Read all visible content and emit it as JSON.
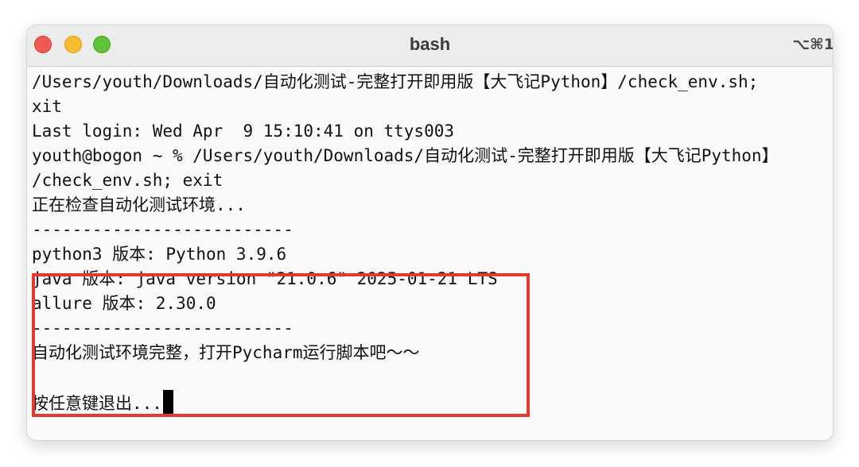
{
  "window": {
    "title": "bash",
    "shortcut": "⌥⌘1",
    "traffic_lights": {
      "close_icon": "×",
      "minimize_icon": "−",
      "maximize_icon": "+"
    }
  },
  "terminal": {
    "lines": [
      "/Users/youth/Downloads/自动化测试-完整打开即用版【大飞记Python】/check_env.sh;",
      "xit",
      "Last login: Wed Apr  9 15:10:41 on ttys003",
      "youth@bogon ~ % /Users/youth/Downloads/自动化测试-完整打开即用版【大飞记Python】",
      "/check_env.sh; exit",
      "正在检查自动化测试环境...",
      "--------------------------",
      "python3 版本: Python 3.9.6",
      "java 版本: java version \"21.0.6\" 2025-01-21 LTS",
      "allure 版本: 2.30.0",
      "--------------------------",
      "自动化测试环境完整，打开Pycharm运行脚本吧～～",
      "",
      "按任意键退出..."
    ]
  },
  "colors": {
    "highlight_border": "#e23a2c",
    "close": "#ee5a51",
    "minimize": "#f6bd2e",
    "maximize": "#5fc438"
  }
}
